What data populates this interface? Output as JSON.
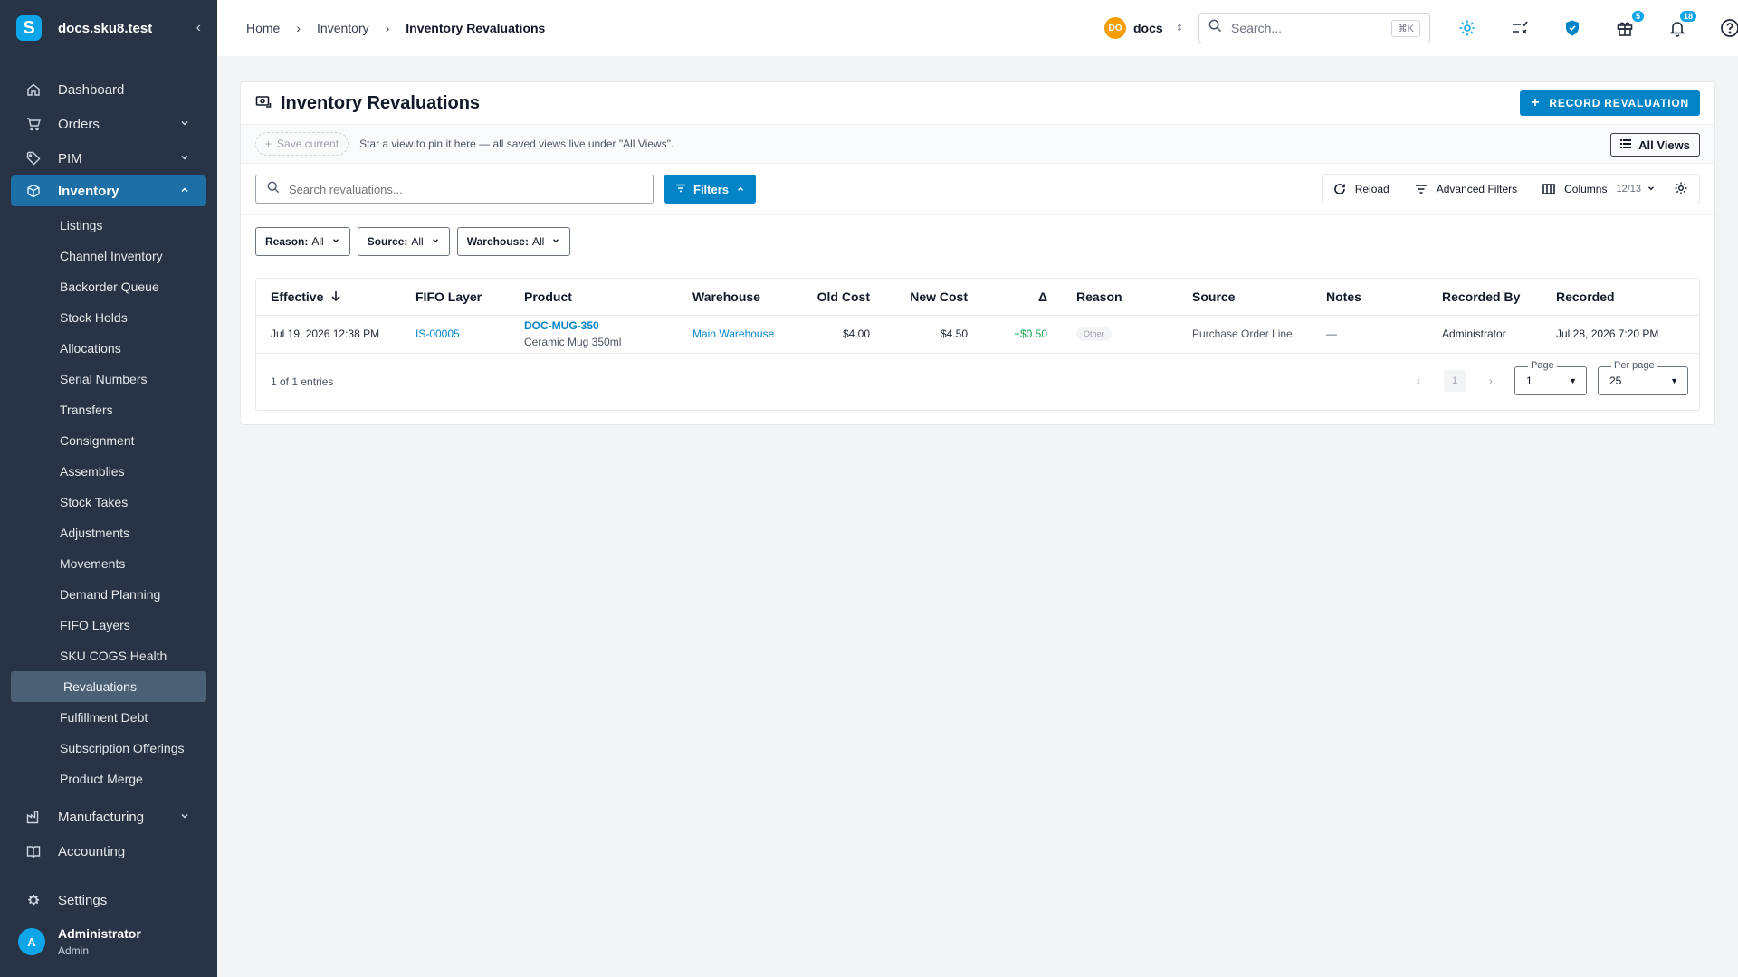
{
  "brand": {
    "name": "docs.sku8.test",
    "logo_letter": "S"
  },
  "sidebar": {
    "items": [
      {
        "label": "Dashboard"
      },
      {
        "label": "Orders"
      },
      {
        "label": "PIM"
      },
      {
        "label": "Inventory"
      }
    ],
    "inventory_sub": [
      "Listings",
      "Channel Inventory",
      "Backorder Queue",
      "Stock Holds",
      "Allocations",
      "Serial Numbers",
      "Transfers",
      "Consignment",
      "Assemblies",
      "Stock Takes",
      "Adjustments",
      "Movements",
      "Demand Planning",
      "FIFO Layers",
      "SKU COGS Health",
      "Revaluations",
      "Fulfillment Debt",
      "Subscription Offerings",
      "Product Merge"
    ],
    "after": [
      {
        "label": "Manufacturing"
      },
      {
        "label": "Accounting"
      }
    ],
    "settings": "Settings",
    "user": {
      "initial": "A",
      "name": "Administrator",
      "role": "Admin"
    }
  },
  "topbar": {
    "crumbs": [
      "Home",
      "Inventory",
      "Inventory Revaluations"
    ],
    "org": {
      "badge": "DO",
      "name": "docs"
    },
    "search": {
      "placeholder": "Search...",
      "shortcut": "⌘K"
    },
    "badges": {
      "gifts": "5",
      "notifications": "18"
    }
  },
  "page": {
    "title": "Inventory Revaluations",
    "record_button": "RECORD REVALUATION",
    "save_current": "Save current",
    "views_hint": "Star a view to pin it here — all saved views live under \"All Views\".",
    "all_views": "All Views",
    "search_placeholder": "Search revaluations...",
    "filters": "Filters",
    "reload": "Reload",
    "advanced_filters": "Advanced Filters",
    "columns": "Columns",
    "columns_count": "12/13",
    "chips": [
      {
        "key": "Reason:",
        "value": "All"
      },
      {
        "key": "Source:",
        "value": "All"
      },
      {
        "key": "Warehouse:",
        "value": "All"
      }
    ]
  },
  "table": {
    "headers": [
      "Effective",
      "FIFO Layer",
      "Product",
      "Warehouse",
      "Old Cost",
      "New Cost",
      "Δ",
      "Reason",
      "Source",
      "Notes",
      "Recorded By",
      "Recorded"
    ],
    "rows": [
      {
        "effective": "Jul 19, 2026 12:38 PM",
        "fifo_layer": "IS-00005",
        "sku": "DOC-MUG-350",
        "product_name": "Ceramic Mug 350ml",
        "warehouse": "Main Warehouse",
        "old_cost": "$4.00",
        "new_cost": "$4.50",
        "delta": "+$0.50",
        "reason": "Other",
        "source": "Purchase Order Line",
        "notes": "—",
        "recorded_by": "Administrator",
        "recorded": "Jul 28, 2026 7:20 PM"
      }
    ],
    "entries_text": "1 of 1 entries",
    "current_page_button": "1",
    "page_label": "Page",
    "page_value": "1",
    "per_page_label": "Per page",
    "per_page_value": "25"
  },
  "colors": {
    "sidebar_bg": "#283445",
    "accent": "#0284c7",
    "active_nav": "#1e6fa5"
  }
}
